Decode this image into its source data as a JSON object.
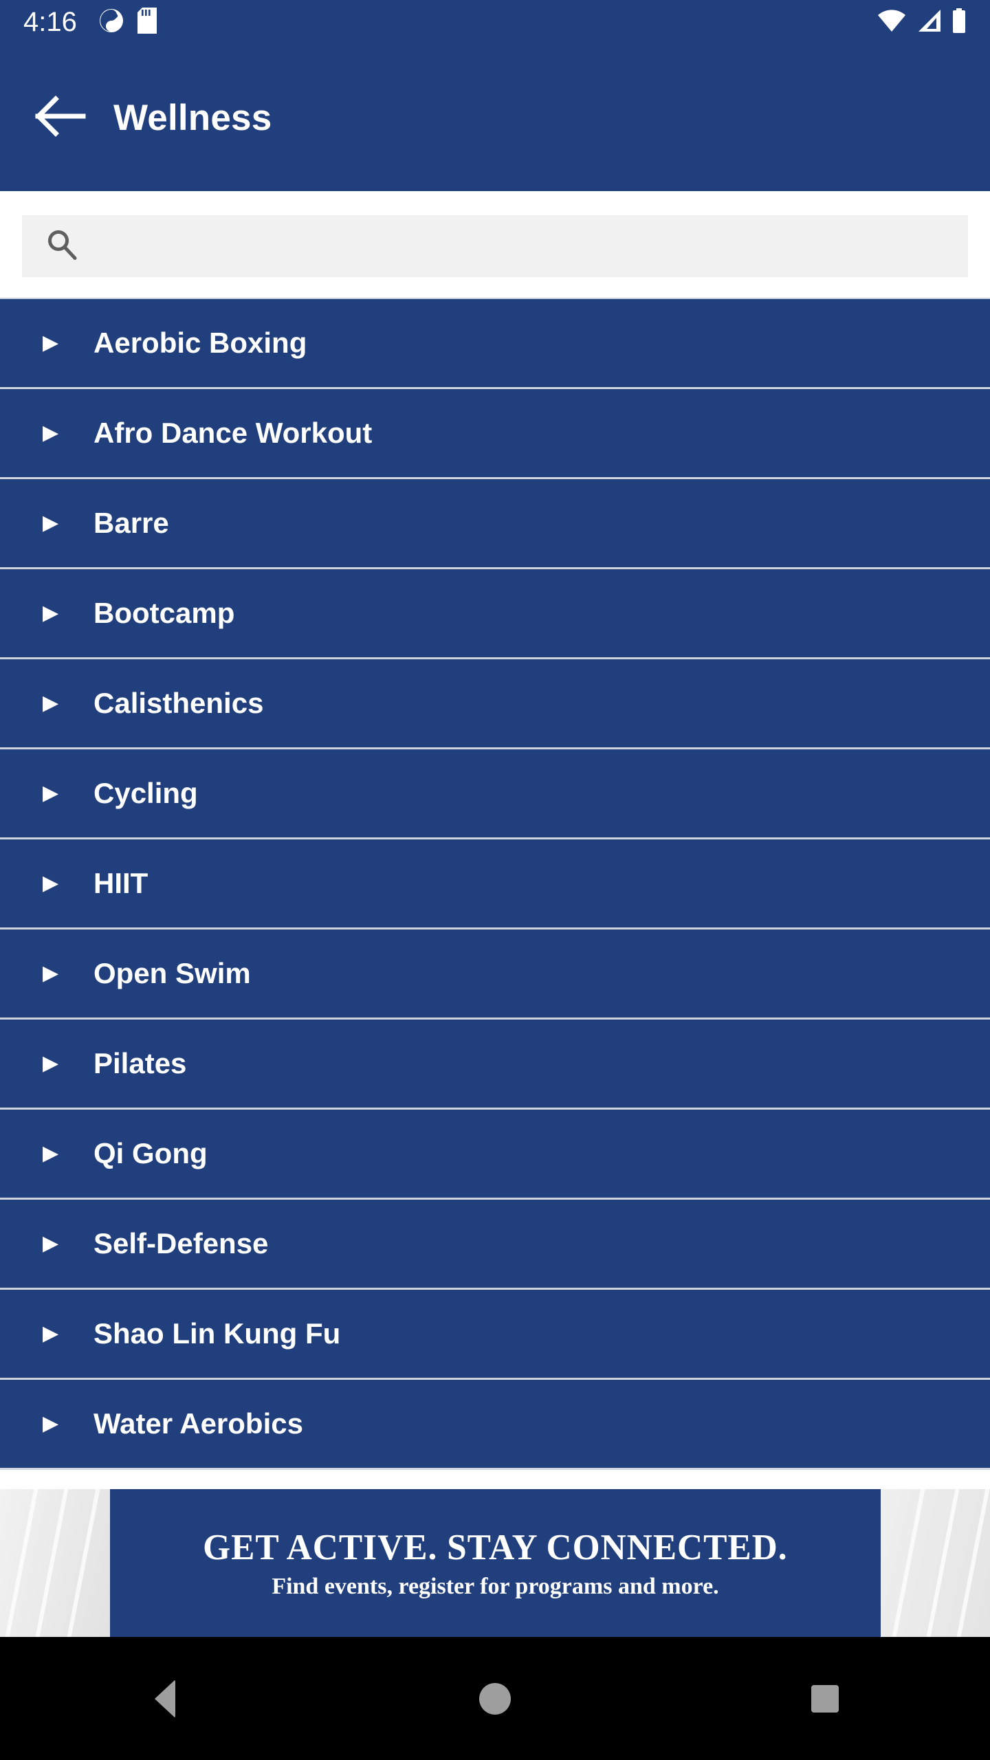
{
  "status_bar": {
    "time": "4:16",
    "left_icons": [
      "mood-icon",
      "sd-card-icon"
    ],
    "right_icons": [
      "wifi-icon",
      "cellular-signal-icon",
      "battery-icon"
    ],
    "background_color": "#223F7D"
  },
  "app_bar": {
    "back_icon": "arrow-left-icon",
    "title": "Wellness",
    "background_color": "#223F7D"
  },
  "search": {
    "icon": "search-icon",
    "value": "",
    "placeholder": ""
  },
  "list": {
    "background_color": "#223F7D",
    "divider_color": "#cfd4dd",
    "caret_glyph": "▶",
    "items": [
      {
        "label": "Aerobic Boxing"
      },
      {
        "label": "Afro Dance Workout"
      },
      {
        "label": "Barre"
      },
      {
        "label": "Bootcamp"
      },
      {
        "label": "Calisthenics"
      },
      {
        "label": "Cycling"
      },
      {
        "label": "HIIT"
      },
      {
        "label": "Open Swim"
      },
      {
        "label": "Pilates"
      },
      {
        "label": "Qi Gong"
      },
      {
        "label": "Self-Defense"
      },
      {
        "label": "Shao Lin Kung Fu"
      },
      {
        "label": "Water Aerobics"
      }
    ]
  },
  "banner": {
    "headline": "GET ACTIVE.  STAY CONNECTED.",
    "subline": "Find events, register for programs and more.",
    "panel_color": "#223F7D"
  },
  "nav_bar": {
    "buttons": [
      {
        "name": "back",
        "icon": "triangle-left-icon"
      },
      {
        "name": "home",
        "icon": "circle-icon"
      },
      {
        "name": "recents",
        "icon": "square-icon"
      }
    ],
    "background_color": "#000000"
  }
}
